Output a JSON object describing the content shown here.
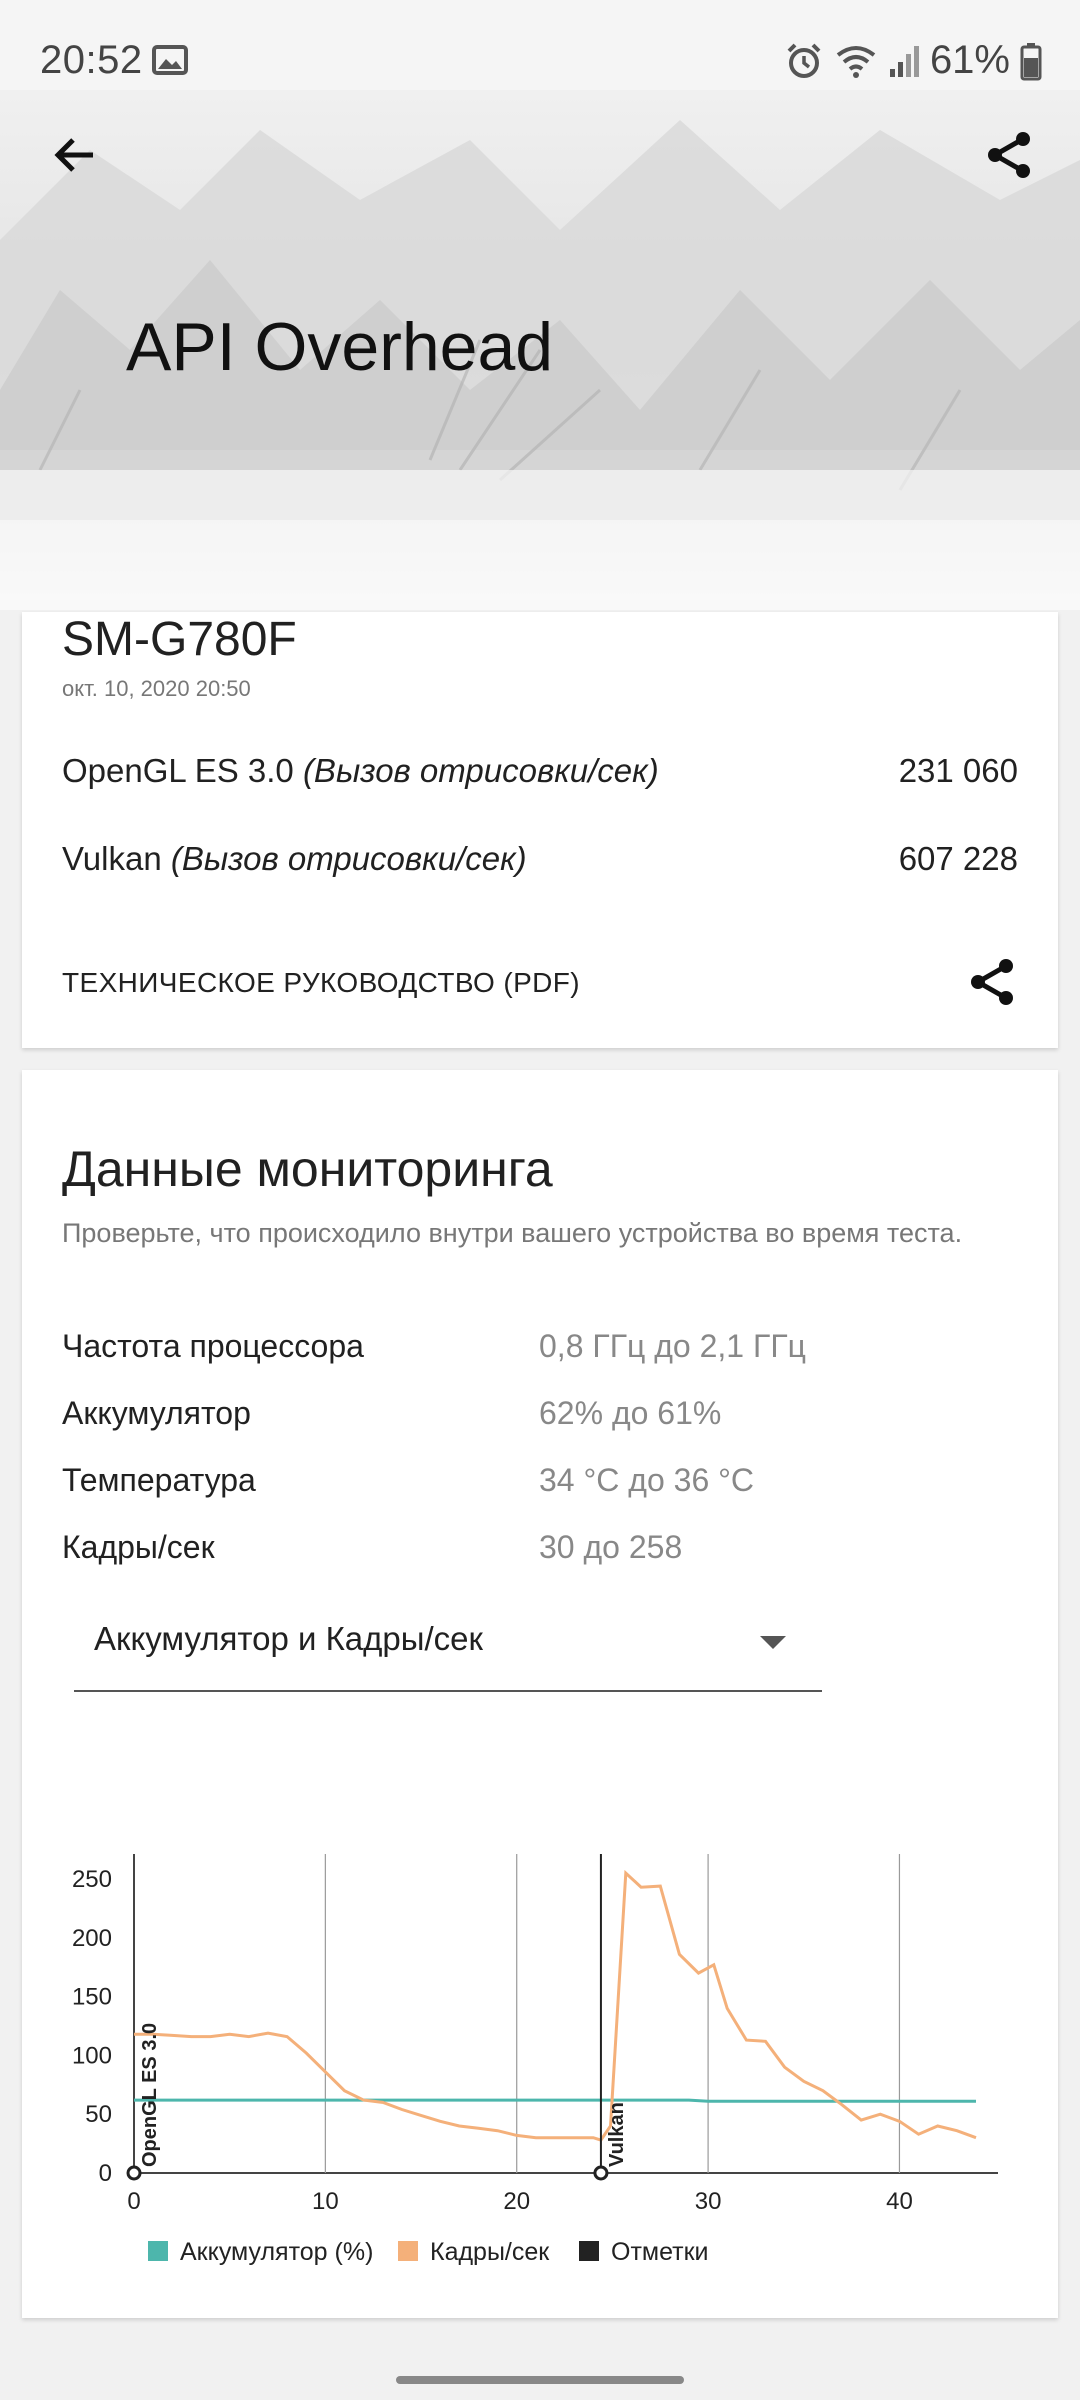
{
  "status_bar": {
    "time": "20:52",
    "battery": "61%",
    "icons": [
      "image-icon",
      "alarm-icon",
      "wifi-icon",
      "signal-icon",
      "battery-icon"
    ]
  },
  "header": {
    "title": "API Overhead"
  },
  "result_card": {
    "device": "SM-G780F",
    "date": "окт. 10, 2020 20:50",
    "scores": [
      {
        "api": "OpenGL ES 3.0",
        "unit": "(Вызов отрисовки/сек)",
        "value": "231 060"
      },
      {
        "api": "Vulkan",
        "unit": "(Вызов отрисовки/сек)",
        "value": "607 228"
      }
    ],
    "tech_guide": "ТЕХНИЧЕСКОЕ РУКОВОДСТВО (PDF)"
  },
  "monitoring": {
    "title": "Данные мониторинга",
    "subtitle": "Проверьте, что происходило внутри вашего устройства во время теста.",
    "rows": [
      {
        "label": "Частота процессора",
        "value": "0,8 ГГц до 2,1 ГГц"
      },
      {
        "label": "Аккумулятор",
        "value": "62% до 61%"
      },
      {
        "label": "Температура",
        "value": "34 °C до 36 °C"
      },
      {
        "label": "Кадры/сек",
        "value": "30 до 258"
      }
    ],
    "selector": {
      "value": "Аккумулятор и Кадры/сек"
    }
  },
  "colors": {
    "battery": "#4db6ac",
    "fps": "#f4b07a",
    "markers": "#222222"
  },
  "chart_data": {
    "type": "line",
    "xlim": [
      0,
      44
    ],
    "ylim": [
      0,
      260
    ],
    "x_ticks": [
      "0",
      "10",
      "20",
      "30",
      "40"
    ],
    "y_ticks": [
      "0",
      "50",
      "100",
      "150",
      "200",
      "250"
    ],
    "series": [
      {
        "name": "Аккумулятор (%)",
        "color": "#4db6ac",
        "x": [
          0,
          29,
          30,
          44
        ],
        "y": [
          62,
          62,
          61,
          61
        ]
      },
      {
        "name": "Кадры/сек",
        "color": "#f4b07a",
        "x": [
          0,
          1,
          2,
          3,
          4,
          5,
          6,
          7,
          8,
          9,
          10,
          11,
          12,
          13,
          14,
          15,
          16,
          17,
          18,
          19,
          20,
          21,
          22,
          23,
          24,
          24.4,
          24.9,
          25.7,
          26.5,
          27.5,
          28.5,
          29.5,
          30.3,
          31,
          32,
          33,
          34,
          35,
          36,
          37,
          38,
          39,
          40,
          41,
          42,
          43,
          44
        ],
        "y": [
          118,
          118,
          117,
          116,
          116,
          118,
          116,
          119,
          116,
          102,
          86,
          70,
          62,
          60,
          54,
          49,
          44,
          40,
          38,
          36,
          32,
          30,
          30,
          30,
          30,
          28,
          40,
          255,
          243,
          244,
          186,
          170,
          177,
          140,
          113,
          112,
          90,
          78,
          70,
          58,
          45,
          50,
          44,
          33,
          40,
          36,
          30
        ]
      }
    ],
    "markers": [
      {
        "x": 0,
        "label": "OpenGL ES 3.0"
      },
      {
        "x": 24.4,
        "label": "Vulkan"
      }
    ],
    "legend": [
      "Аккумулятор (%)",
      "Кадры/сек",
      "Отметки"
    ],
    "legend_position": "bottom",
    "grid": true
  }
}
